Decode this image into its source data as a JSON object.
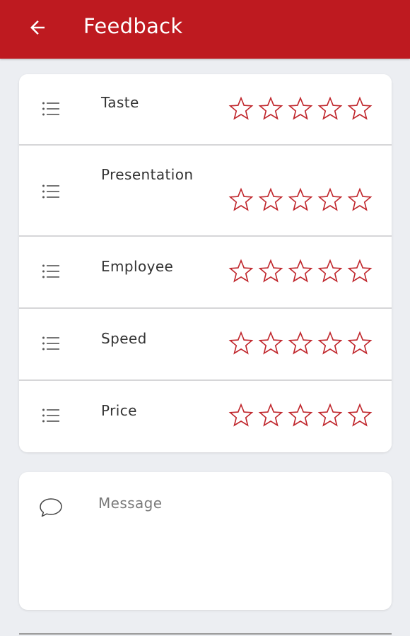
{
  "appbar": {
    "title": "Feedback",
    "back_icon": "arrow-left-icon",
    "color": "#be1a20"
  },
  "ratings": [
    {
      "label": "Taste",
      "rating": 0,
      "max": 5
    },
    {
      "label": "Presentation",
      "rating": 0,
      "max": 5
    },
    {
      "label": "Employee",
      "rating": 0,
      "max": 5
    },
    {
      "label": "Speed",
      "rating": 0,
      "max": 5
    },
    {
      "label": "Price",
      "rating": 0,
      "max": 5
    }
  ],
  "row_icon": "list-icon",
  "star_color": "#c0272d",
  "message": {
    "icon": "chat-bubble-icon",
    "placeholder": "Message",
    "value": ""
  }
}
